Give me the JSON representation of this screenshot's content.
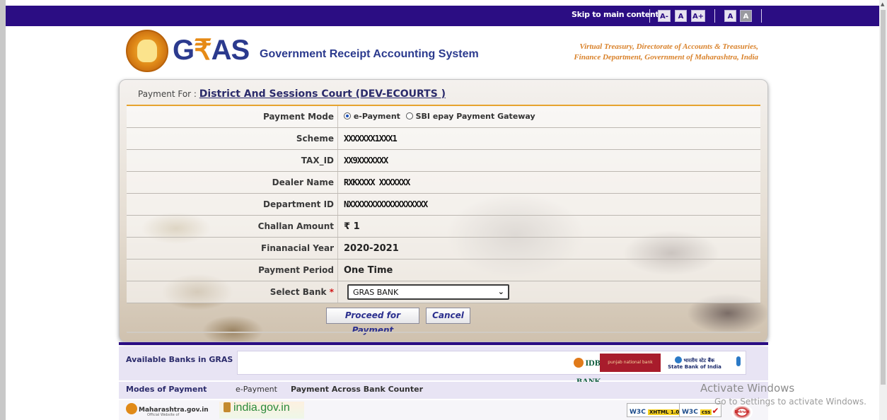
{
  "topbar": {
    "skip_link": "Skip to main content",
    "font_buttons": [
      "A-",
      "A",
      "A+"
    ],
    "contrast_buttons": [
      "A",
      "A"
    ]
  },
  "header": {
    "logo_text_1": "G",
    "logo_text_rupee": "₹",
    "logo_text_2": "AS",
    "logo_subtitle": "Government Receipt Accounting System",
    "tagline_1": "Virtual Treasury, Directorate of Accounts & Treasuries,",
    "tagline_2": "Finance Department, Government of Maharashtra, India"
  },
  "form": {
    "payment_for_label": "Payment For :",
    "payment_for_value": "District And Sessions Court (DEV-ECOURTS )",
    "rows": [
      {
        "label": "Payment Mode",
        "value": ""
      },
      {
        "label": "Scheme",
        "value": "XXXXXXX1XXX1"
      },
      {
        "label": "TAX_ID",
        "value": "XX9XXXXXXX"
      },
      {
        "label": "Dealer Name",
        "value": "RXKXXXX XXXXXXX"
      },
      {
        "label": "Department ID",
        "value": "NXXXXXXXXXXXXXXXXXX"
      },
      {
        "label": "Challan Amount",
        "value": "₹ 1"
      },
      {
        "label": "Finanacial Year",
        "value": "2020-2021"
      },
      {
        "label": "Payment Period",
        "value": "One Time"
      },
      {
        "label": "Select Bank",
        "value": ""
      }
    ],
    "payment_mode_options": [
      "e-Payment",
      "SBI epay Payment Gateway"
    ],
    "payment_mode_selected": "e-Payment",
    "required_marker": "*",
    "bank_selected": "GRAS BANK",
    "proceed_button": "Proceed for Payment",
    "cancel_button": "Cancel"
  },
  "banks": {
    "label": "Available Banks in GRAS",
    "logos": [
      "IDBI BANK",
      "punjab national bank",
      "भारतीय स्टेट बैंक",
      "State Bank of India"
    ]
  },
  "modes": {
    "label": "Modes of Payment",
    "items": [
      "e-Payment",
      "Payment Across Bank Counter"
    ]
  },
  "footer": {
    "maharashtra": "Maharashtra.gov.in",
    "maharashtra_sub": "Official Website of",
    "india": "india.gov.in",
    "w3c_xhtml": "W3C",
    "w3c_xhtml_tag": "XHTML 1.0",
    "w3c_css": "W3C",
    "w3c_css_tag": "css",
    "entrust": "Entrust"
  },
  "windows": {
    "activate_title": "Activate Windows",
    "activate_sub": "Go to Settings to activate Windows."
  }
}
